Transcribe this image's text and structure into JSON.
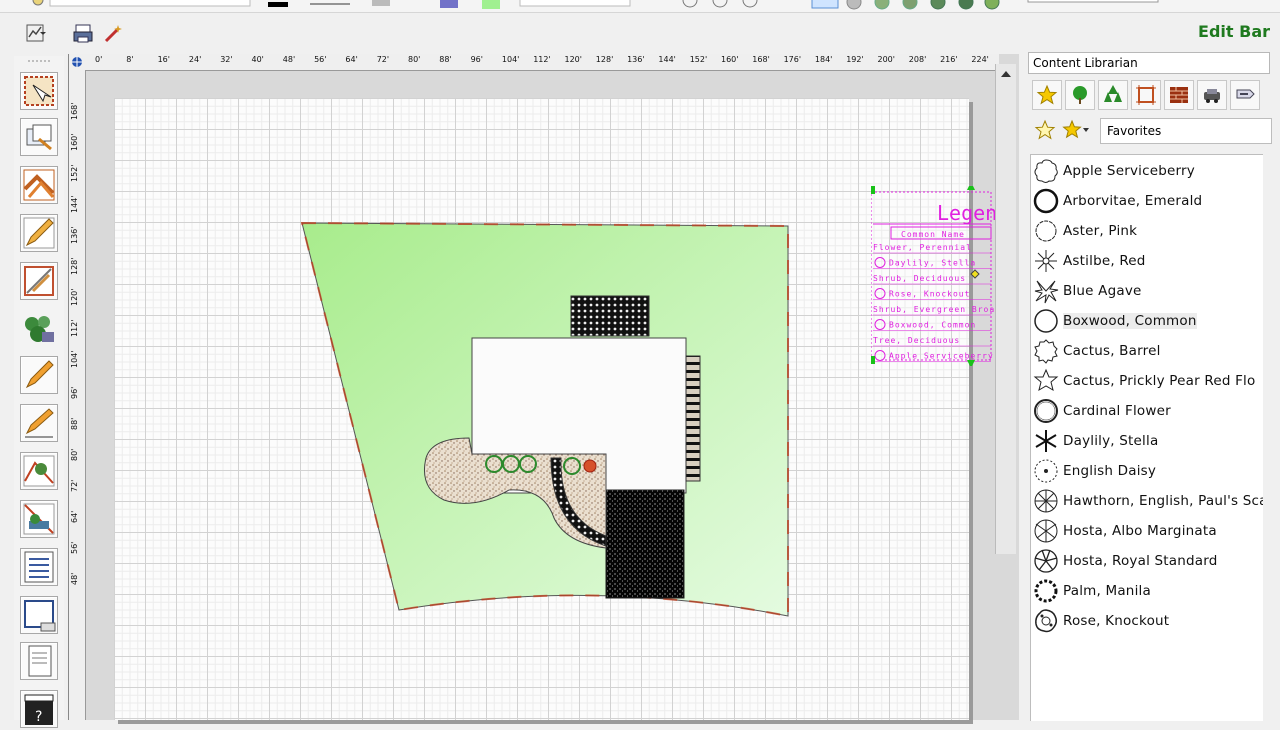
{
  "window": {
    "edit_bar_label": "Edit Bar"
  },
  "ruler": {
    "top_ticks": [
      "0'",
      "8'",
      "16'",
      "24'",
      "32'",
      "40'",
      "48'",
      "56'",
      "64'",
      "72'",
      "80'",
      "88'",
      "96'",
      "104'",
      "112'",
      "120'",
      "128'",
      "136'",
      "144'",
      "152'",
      "160'",
      "168'",
      "176'",
      "184'",
      "192'",
      "200'",
      "208'",
      "216'",
      "224'"
    ],
    "left_ticks": [
      "168'",
      "160'",
      "152'",
      "144'",
      "136'",
      "128'",
      "120'",
      "112'",
      "104'",
      "96'",
      "88'",
      "80'",
      "72'",
      "64'",
      "56'",
      "48'"
    ]
  },
  "legend": {
    "title": "Legend",
    "header": "Common Name",
    "rows": [
      "Flower, Perennial",
      "Daylily, Stella",
      "Shrub, Deciduous",
      "Rose, Knockout",
      "Shrub, Evergreen Broadleaf",
      "Boxwood, Common",
      "Tree, Deciduous",
      "Apple Serviceberry"
    ]
  },
  "content_librarian": {
    "title": "Content Librarian",
    "categories": [
      "star-icon",
      "tree-icon",
      "trees-icon",
      "structure-icon",
      "brick-icon",
      "vehicle-icon",
      "tools-icon"
    ],
    "favorites_label": "Favorites",
    "plants": [
      {
        "name": "Apple Serviceberry",
        "icon": "serviceberry-symbol-icon"
      },
      {
        "name": "Arborvitae, Emerald",
        "icon": "arborvitae-symbol-icon"
      },
      {
        "name": "Aster, Pink",
        "icon": "aster-symbol-icon"
      },
      {
        "name": "Astilbe, Red",
        "icon": "astilbe-symbol-icon"
      },
      {
        "name": "Blue Agave",
        "icon": "agave-symbol-icon"
      },
      {
        "name": "Boxwood, Common",
        "icon": "boxwood-symbol-icon"
      },
      {
        "name": "Cactus, Barrel",
        "icon": "barrel-cactus-symbol-icon"
      },
      {
        "name": "Cactus, Prickly Pear Red Flo",
        "icon": "prickly-pear-symbol-icon"
      },
      {
        "name": "Cardinal Flower",
        "icon": "cardinal-flower-symbol-icon"
      },
      {
        "name": "Daylily, Stella",
        "icon": "daylily-symbol-icon"
      },
      {
        "name": "English Daisy",
        "icon": "daisy-symbol-icon"
      },
      {
        "name": "Hawthorn, English, Paul's Sca",
        "icon": "hawthorn-symbol-icon"
      },
      {
        "name": "Hosta, Albo Marginata",
        "icon": "hosta-albo-symbol-icon"
      },
      {
        "name": "Hosta, Royal Standard",
        "icon": "hosta-royal-symbol-icon"
      },
      {
        "name": "Palm, Manila",
        "icon": "palm-symbol-icon"
      },
      {
        "name": "Rose, Knockout",
        "icon": "rose-symbol-icon"
      }
    ],
    "selected_plant": "Boxwood, Common"
  },
  "colors": {
    "lawn": "#a8ec8c",
    "legend_magenta": "#e020e0",
    "edit_bar_green": "#1f7a1f",
    "selection_handle": "#19c119"
  }
}
